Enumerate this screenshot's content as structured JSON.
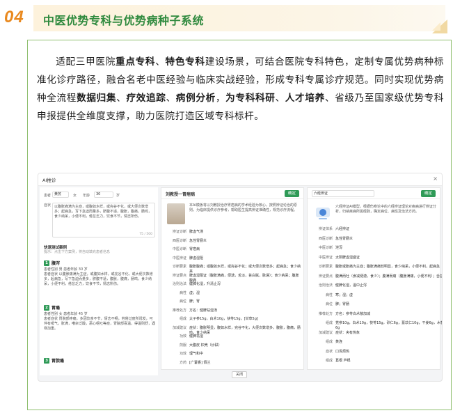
{
  "header": {
    "number": "04",
    "title": "中医优势专科与优势病种子系统"
  },
  "intro": {
    "s1": "适配三甲医院",
    "b1": "重点专科",
    "s2": "、",
    "b2": "特色专科",
    "s3": "建设场景，可结合医院专科特色，定制专属优势病种标准化诊疗路径，融合名老中医经验与临床实战经验，形成专科专属诊疗规范。同时实现优势病种全流程",
    "b3": "数据归集",
    "s4": "、",
    "b4": "疗效追踪",
    "s5": "、",
    "b5": "病例分析",
    "s6": "，",
    "b6": "为专科科研",
    "s7": "、",
    "b7": "人才培养",
    "s8": "、省级乃至国家级优势专科申报提供全维度支撑，助力医院打造区域专科标杆。"
  },
  "app": {
    "window_title": "AI推诊",
    "close_glyph": "×",
    "form": {
      "name_label": "患者",
      "name_value": "黄芪",
      "sex_label": "女",
      "age_label": "年龄",
      "age_value": "30",
      "age_unit": "岁",
      "symptom_label": "症状",
      "symptom_text": "以腹胀痛满为主症，或腹如水样，或完谷不化，或大便次数增多；起病急，写下急迫而量多，脐腹不适，腹胀，腹痛，肠鸣，食少纳呆，小便不利，倦怠乏力，饮食不节，情志所伤。",
      "char_count": "75 / 500"
    },
    "quick_test": {
      "title": "快速测试案例",
      "hint": "提示：点击下方案例，将自动填充患者信息",
      "cases": [
        {
          "num": "1",
          "title": "腹泻",
          "meta": "患者性别 男  患者年龄 30 岁",
          "text": "患者症状 以腹胀痛满为主症，或腹如水样，或完谷不化，或大便次数增多，起病急，写下急迫而量多，脐腹不适，腹胀，腹痛，肠鸣，食少纳呆，小便不利，倦怠乏力，饮食不节，情志所伤。"
        },
        {
          "num": "2",
          "title": "胃痛",
          "meta": "患者性别 女  患者年龄 45 岁",
          "text": "患者症状 胃脘部疼痛，多因饮食不节，情志不畅，劳倦过度所诱发，可伴有嗳气，胀满，嘈杂泛酸，恶心呕吐等症，胃脘部喜温，得温则舒，遇寒加重。"
        },
        {
          "num": "3",
          "title": "胃脘痛",
          "meta": "",
          "text": ""
        }
      ]
    },
    "mid": {
      "title": "刘教授一胃痞病",
      "confirm_label": "确定",
      "desc": "本AI模板将以刘教授治疗胃痞病的学术经验为核心，按照辨证论治的原则，为临床提供诊疗参考，帮助医生提高辨证准确性，规范诊疗流程。",
      "fields": [
        {
          "k": "辨证诊断",
          "v": "脾虚气滞"
        },
        {
          "k": "西医诊断",
          "v": "急性胃肠炎"
        },
        {
          "k": "中医诊断",
          "v": "胃痞病"
        },
        {
          "k": "中医辨证",
          "v": "脾虚湿阻"
        },
        {
          "k": "诊断要素",
          "v": "腹胀腹痛；或腹如水样，或完谷不化；或大便次数增多；起病急；食少纳呆"
        },
        {
          "k": "辨证要点",
          "v": "脾虚湿阻证（腹胀满痛，便溏，舌淡，苔白腻，脉濡）；食少纳呆；腹胀腹痛"
        },
        {
          "k": "治则治法",
          "v": "健脾化湿，升清止泻"
        },
        {
          "k": "病性",
          "v": "虚；湿"
        },
        {
          "k": "病位",
          "v": "脾；胃"
        },
        {
          "k": "推荐处方",
          "v": "方名：健脾祛湿汤"
        },
        {
          "k": "组成",
          "v": "太子参15g，白术10g，茯苓15g，[甘草5g]"
        },
        {
          "k": "加减建议",
          "v": "症状：腹胀明显，腹如水样，完谷不化，大便次数增多，腹胀，腹痛，肠鸣，食少纳呆"
        },
        {
          "k": "功效",
          "v": "健脾祛湿"
        },
        {
          "k": "煎服",
          "v": "大腹皮 枳壳（炒麸）"
        },
        {
          "k": "功效",
          "v": "理气和中"
        },
        {
          "k": "方药",
          "v": "[广藿香] 佩兰"
        }
      ]
    },
    "right": {
      "select_value": "六经辨证",
      "confirm_label": "确定",
      "desc": "六经辨证AI模型，根据伤寒论中的六经辨证理论对疾病进行辨证分析，归纳疾病所属经脉，确定病位、病性及治法方药。",
      "fields": [
        {
          "k": "辨证体系",
          "v": "六经辨证"
        },
        {
          "k": "西医诊断",
          "v": "急性胃肠炎"
        },
        {
          "k": "中医诊断",
          "v": "泄泻"
        },
        {
          "k": "中医辨证",
          "v": "太阴脾虚湿盛证"
        },
        {
          "k": "诊断要素",
          "v": "腹胀或胀痛为主症；腹胀满痛较明显，食少纳呆，小便不利，起病急"
        },
        {
          "k": "辨证要点",
          "v": "腹满而吐（食减便溏，食少）；腹满而痛（腹胀满痛，小便不利）；舌苔腻"
        },
        {
          "k": "治则治法",
          "v": "健脾化湿，温中止泻"
        },
        {
          "k": "病性",
          "v": "寒；湿；虚"
        },
        {
          "k": "病位",
          "v": "脾；胃肠"
        },
        {
          "k": "推荐处方",
          "v": "方名：参苓白术散加减"
        },
        {
          "k": "组成",
          "v": "党参10g，白术10g，茯苓15g，砂仁6g，薏苡仁10g，干姜6g，木香6g"
        },
        {
          "k": "加减建议",
          "v": "症状：夹有热象"
        },
        {
          "k": "组成",
          "v": "黄连"
        },
        {
          "k": "症状",
          "v": "口渴烦热"
        },
        {
          "k": "组成",
          "v": "葛根 芦根"
        }
      ]
    },
    "close_label": "关闭"
  }
}
